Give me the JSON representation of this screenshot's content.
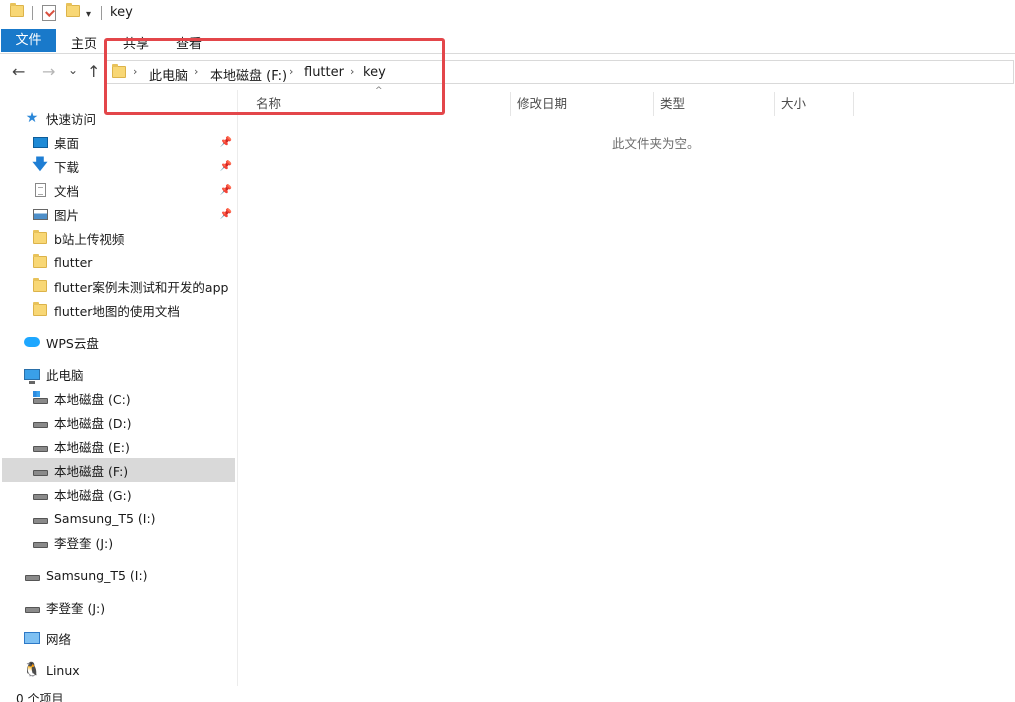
{
  "window": {
    "title": "key"
  },
  "quick_access_toolbar": {
    "dropdown_glyph": "▾"
  },
  "ribbon": {
    "file_tab": "文件",
    "tabs": [
      "主页",
      "共享",
      "查看"
    ]
  },
  "nav_buttons": {
    "back": "←",
    "forward": "→",
    "recent": "⌄",
    "up": "↑"
  },
  "address": {
    "crumbs": [
      "此电脑",
      "本地磁盘 (F:)",
      "flutter",
      "key"
    ],
    "separator": "›"
  },
  "columns": {
    "sort_glyph": "^",
    "headers": [
      "名称",
      "修改日期",
      "类型",
      "大小"
    ]
  },
  "content": {
    "empty_message": "此文件夹为空。"
  },
  "nav_pane": {
    "quick_access": "快速访问",
    "pinned": [
      {
        "label": "桌面",
        "icon": "desktop-icon"
      },
      {
        "label": "下载",
        "icon": "download-icon"
      },
      {
        "label": "文档",
        "icon": "document-icon"
      },
      {
        "label": "图片",
        "icon": "pictures-icon"
      }
    ],
    "recent_folders": [
      "b站上传视频",
      "flutter",
      "flutter案例未测试和开发的app",
      "flutter地图的使用文档"
    ],
    "wps": "WPS云盘",
    "this_pc": "此电脑",
    "drives": [
      "本地磁盘 (C:)",
      "本地磁盘 (D:)",
      "本地磁盘 (E:)",
      "本地磁盘 (F:)",
      "本地磁盘 (G:)",
      "Samsung_T5 (I:)",
      "李登奎 (J:)"
    ],
    "selected_drive": "本地磁盘 (F:)",
    "external": [
      "Samsung_T5 (I:)",
      "李登奎 (J:)"
    ],
    "network": "网络",
    "linux": "Linux"
  },
  "status": {
    "item_count": "0 个项目"
  },
  "colors": {
    "accent": "#1979ca",
    "highlight_border": "#e3464a",
    "selection": "#d9d9d9"
  }
}
